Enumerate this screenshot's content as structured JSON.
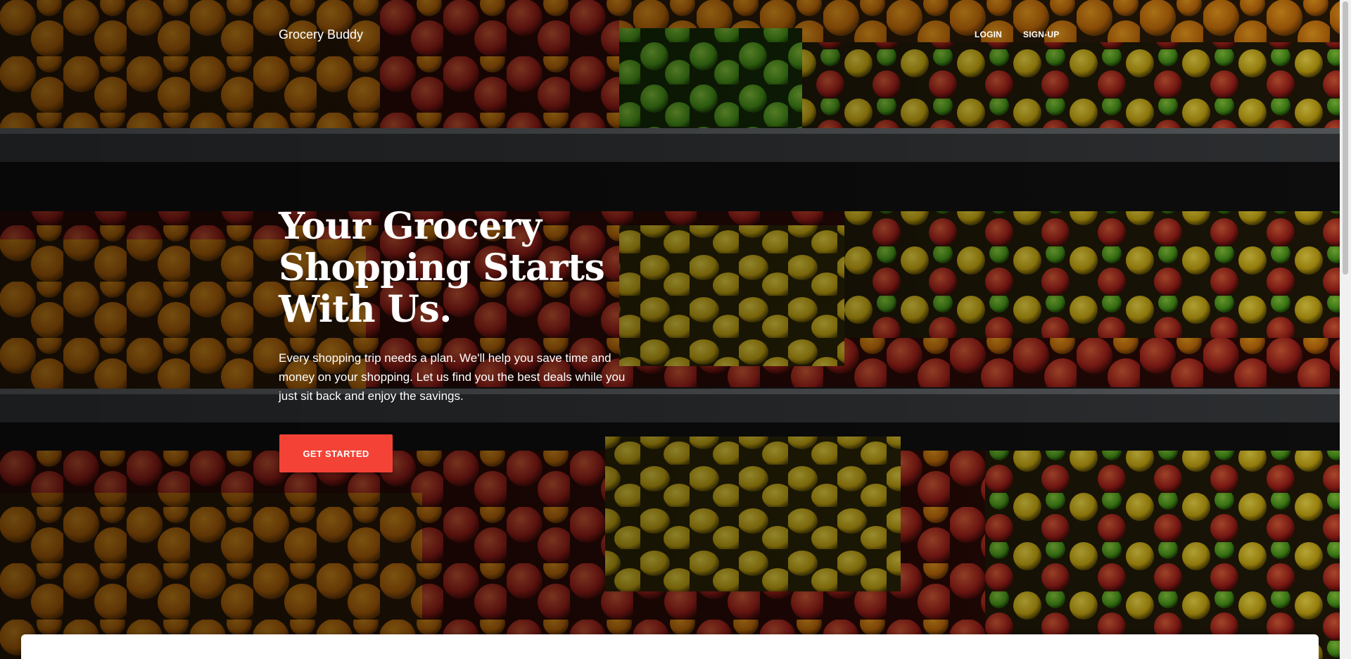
{
  "navbar": {
    "brand": "Grocery Buddy",
    "links": [
      {
        "label": "LOGIN"
      },
      {
        "label": "SIGN-UP"
      }
    ]
  },
  "hero": {
    "title_line1": "Your Grocery",
    "title_line2": "Shopping Starts",
    "title_line3": "With Us.",
    "text": "Every shopping trip needs a plan. We'll help you save time and money on your shopping. Let us find you the best deals while you just sit back and enjoy the savings.",
    "cta_label": "GET STARTED"
  },
  "colors": {
    "accent": "#f44336",
    "text_on_dark": "#ffffff"
  },
  "background": {
    "semantic": "produce-shelves-photo"
  }
}
